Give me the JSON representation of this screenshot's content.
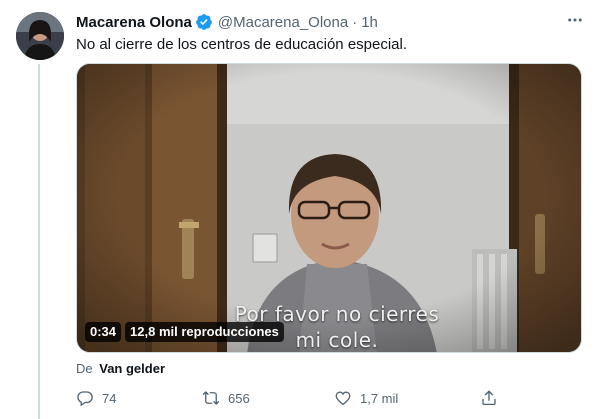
{
  "tweet": {
    "display_name": "Macarena Olona",
    "handle": "@Macarena_Olona",
    "separator": "·",
    "time": "1h",
    "text": "No al cierre de los centros de educación especial.",
    "verified_color": "#1d9bf0"
  },
  "video": {
    "duration": "0:34",
    "views": "12,8 mil reproducciones",
    "subtitle_line1": "Por favor no cierres",
    "subtitle_line2": "mi cole."
  },
  "attribution": {
    "prefix": "De",
    "author": "Van gelder"
  },
  "actions": {
    "replies": "74",
    "retweets": "656",
    "likes": "1,7 mil"
  },
  "icons": [
    "more-icon",
    "verified-badge-icon",
    "reply-icon",
    "retweet-icon",
    "like-icon",
    "share-icon"
  ],
  "colors": {
    "text": "#0f1419",
    "secondary": "#536471",
    "accent": "#1d9bf0"
  }
}
